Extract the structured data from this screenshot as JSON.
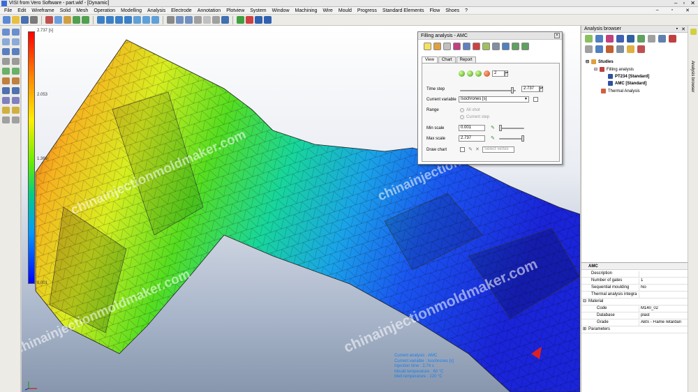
{
  "window": {
    "title": "VISI from Vero Software - part.wkf - [Dynamic]",
    "controls": [
      "–",
      "▫",
      "✕"
    ]
  },
  "menu": {
    "items": [
      "File",
      "Edit",
      "Wireframe",
      "Solid",
      "Mesh",
      "Operation",
      "Modelling",
      "Analysis",
      "Electrode",
      "Annotation",
      "Plotview",
      "System",
      "Window",
      "Machining",
      "Wire",
      "Mould",
      "Progress",
      "Standard Elements",
      "Flow",
      "Shoes",
      "?"
    ],
    "mdi_controls": [
      "–",
      "▫",
      "✕"
    ]
  },
  "legend": {
    "max": "2.737 [s]",
    "mid_upper": "2.053",
    "mid": "1.369",
    "min": "0.001"
  },
  "watermark": "chinainjectionmoldmaker.com",
  "analysis_info": {
    "lines": [
      "Current analysis : AMC",
      "Current variable : Isochrones [s]",
      "Injection time : 2.74 s",
      "Mould temperature : 60 °C",
      "Melt temperature : 220 °C"
    ]
  },
  "filling_panel": {
    "title": "Filling analysis - AMC",
    "close": "×",
    "tabs": [
      "View",
      "Chart",
      "Report"
    ],
    "steps_value": "2",
    "time_step_label": "Time step",
    "time_step_value": "2.737",
    "current_variable_label": "Current variable",
    "current_variable_value": "Isochrones [s]",
    "range_label": "Range",
    "range_options": [
      "All shot",
      "Current step"
    ],
    "min_scale_label": "Min scale",
    "min_scale_value": "0.001",
    "max_scale_label": "Max scale",
    "max_scale_value": "2.737",
    "draw_chart_label": "Draw chart",
    "select_vertex_placeholder": "Select vertex"
  },
  "analysis_browser": {
    "title": "Analysis browser",
    "controls": [
      "▪",
      "✕"
    ],
    "side_tab_label": "Analysis browser",
    "tree": [
      {
        "label": "Studies",
        "bold": true
      },
      {
        "label": "Filling analysis",
        "bold": false
      },
      {
        "label": "PT234 [Standard]",
        "bold": true
      },
      {
        "label": "AMC [Standard]",
        "bold": true
      },
      {
        "label": "Thermal Analysis",
        "bold": false
      }
    ]
  },
  "properties": {
    "section": "AMC",
    "rows": [
      {
        "key": "Description",
        "value": ""
      },
      {
        "key": "Number of gates",
        "value": "1"
      },
      {
        "key": "Sequential moulding",
        "value": "No"
      },
      {
        "key": "Thermal analysis integra",
        "value": ""
      },
      {
        "key": "Material",
        "value": ""
      },
      {
        "key": "Code",
        "value": "M140_02"
      },
      {
        "key": "Database",
        "value": "plast"
      },
      {
        "key": "Grade",
        "value": "ABS - Flame retardan"
      },
      {
        "key": "Parameters",
        "value": ""
      }
    ]
  },
  "colors": {
    "info_text": "#1a7fe8",
    "watermark": "rgba(255,255,255,0.55)"
  }
}
